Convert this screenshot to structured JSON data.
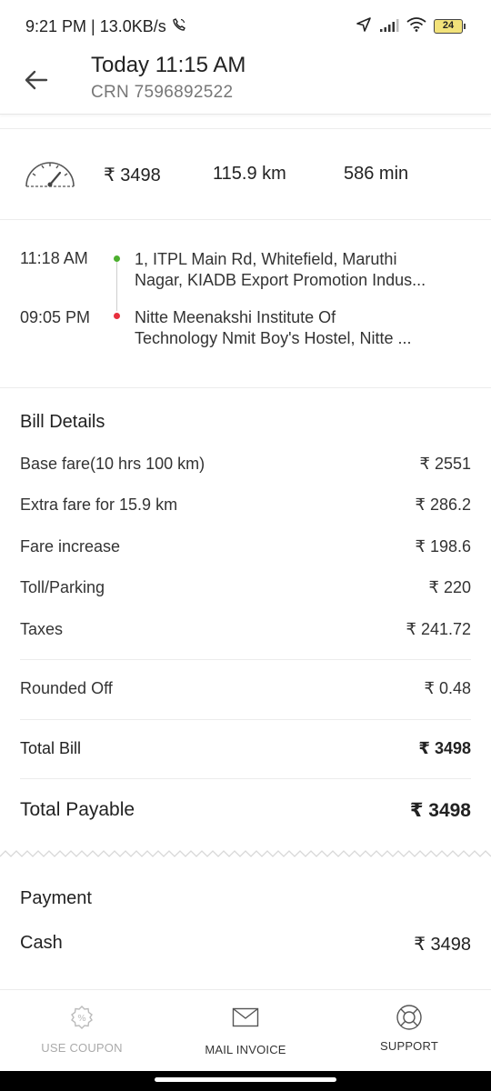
{
  "status_bar": {
    "time_speed": "9:21 PM | 13.0KB/s",
    "battery": "24",
    "icons": [
      "call-icon",
      "location-arrow-icon",
      "signal-icon",
      "wifi-icon",
      "battery-icon"
    ]
  },
  "header": {
    "title": "Today 11:15 AM",
    "crn": "CRN 7596892522",
    "back_icon": "back-arrow-icon"
  },
  "trip_stats": {
    "fare": "₹ 3498",
    "distance": "115.9 km",
    "duration": "586 min",
    "icon": "speedometer-icon"
  },
  "route": {
    "pickup": {
      "time": "11:18 AM",
      "address_line1": "1, ITPL Main Rd, Whitefield, Maruthi",
      "address_line2": "Nagar, KIADB Export Promotion Indus...",
      "dot_color": "#4caf2e"
    },
    "drop": {
      "time": "09:05 PM",
      "address_line1": "Nitte Meenakshi Institute Of",
      "address_line2": "Technology Nmit Boy's Hostel, Nitte ...",
      "dot_color": "#e8303e"
    }
  },
  "bill": {
    "title": "Bill Details",
    "items": [
      {
        "label": "Base fare(10 hrs 100 km)",
        "value": "₹ 2551"
      },
      {
        "label": "Extra fare for 15.9 km",
        "value": "₹ 286.2"
      },
      {
        "label": "Fare increase",
        "value": "₹ 198.6"
      },
      {
        "label": "Toll/Parking",
        "value": "₹ 220"
      },
      {
        "label": "Taxes",
        "value": "₹ 241.72"
      }
    ],
    "rounded_off": {
      "label": "Rounded Off",
      "value": "₹ 0.48"
    },
    "total_bill": {
      "label": "Total Bill",
      "value": "₹ 3498"
    },
    "total_payable": {
      "label": "Total Payable",
      "value": "₹ 3498"
    }
  },
  "payment": {
    "title": "Payment",
    "method": "Cash",
    "amount": "₹ 3498"
  },
  "bottom_nav": {
    "items": [
      {
        "label": "USE COUPON",
        "icon": "coupon-icon",
        "disabled": true
      },
      {
        "label": "MAIL INVOICE",
        "icon": "mail-icon",
        "disabled": false
      },
      {
        "label": "SUPPORT",
        "icon": "support-icon",
        "disabled": false
      }
    ]
  },
  "colors": {
    "pickup_dot": "#4caf2e",
    "drop_dot": "#e8303e",
    "disabled_text": "#aaaaaa"
  }
}
